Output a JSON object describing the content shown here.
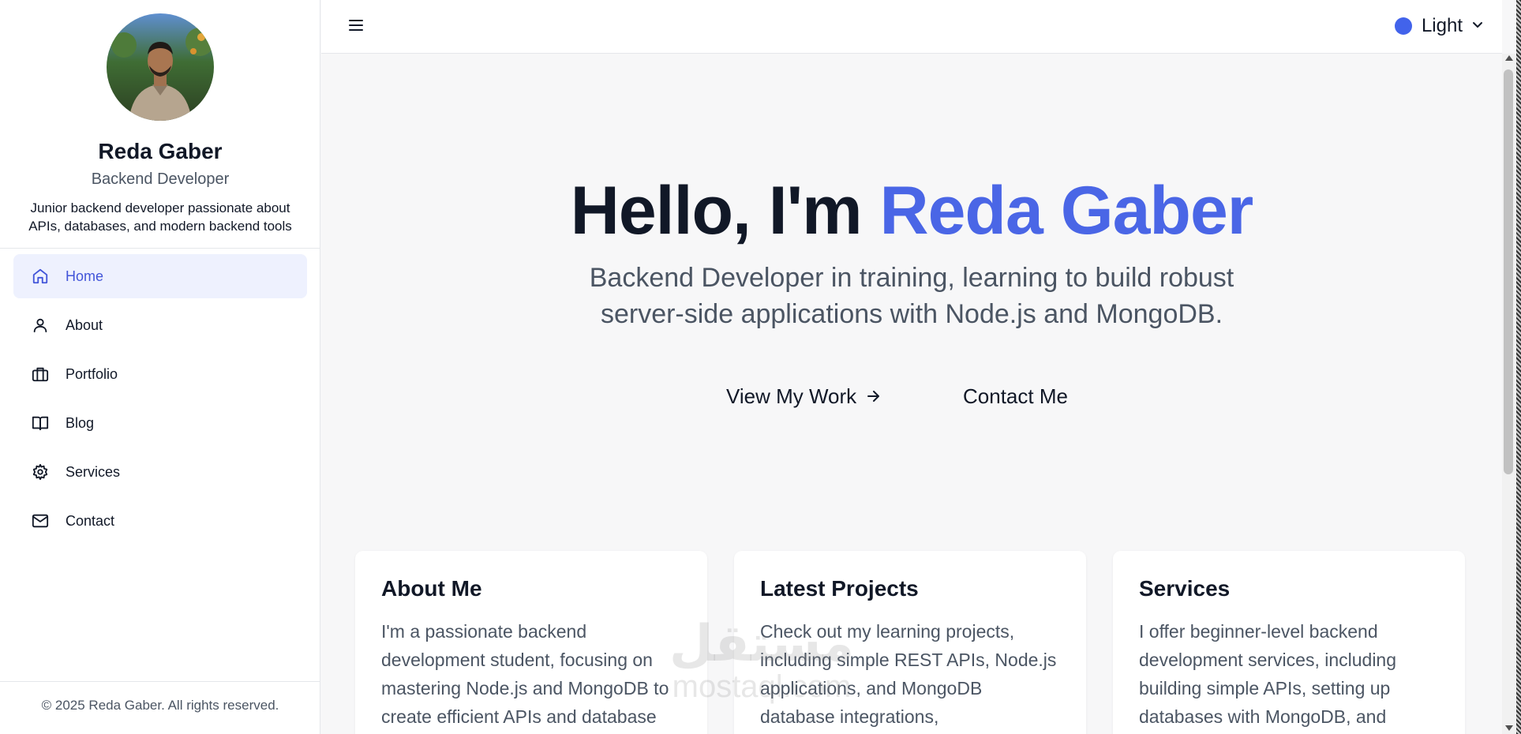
{
  "profile": {
    "name": "Reda Gaber",
    "role": "Backend Developer",
    "bio": "Junior backend developer passionate about APIs, databases, and modern backend tools"
  },
  "nav": {
    "items": [
      {
        "label": "Home",
        "icon": "home-icon",
        "active": true
      },
      {
        "label": "About",
        "icon": "user-icon",
        "active": false
      },
      {
        "label": "Portfolio",
        "icon": "briefcase-icon",
        "active": false
      },
      {
        "label": "Blog",
        "icon": "book-icon",
        "active": false
      },
      {
        "label": "Services",
        "icon": "gear-icon",
        "active": false
      },
      {
        "label": "Contact",
        "icon": "mail-icon",
        "active": false
      }
    ]
  },
  "footer": {
    "copyright": "© 2025 Reda Gaber. All rights reserved."
  },
  "topbar": {
    "theme_label": "Light",
    "theme_color": "#4263eb"
  },
  "hero": {
    "greeting": "Hello, I'm ",
    "name": "Reda Gaber",
    "subtitle": "Backend Developer in training, learning to build robust server-side applications with Node.js and MongoDB.",
    "view_work_label": "View My Work",
    "contact_label": "Contact Me"
  },
  "cards": [
    {
      "title": "About Me",
      "text": "I'm a passionate backend development student, focusing on mastering Node.js and MongoDB to create efficient APIs and database"
    },
    {
      "title": "Latest Projects",
      "text": "Check out my learning projects, including simple REST APIs, Node.js applications, and MongoDB database integrations,"
    },
    {
      "title": "Services",
      "text": "I offer beginner-level backend development services, including building simple APIs, setting up databases with MongoDB, and"
    }
  ],
  "watermark": {
    "arabic": "مستقل",
    "latin": "mostaql.com"
  },
  "colors": {
    "accent": "#4a66e6",
    "active_bg": "#eef1fe",
    "active_text": "#4255d9"
  }
}
